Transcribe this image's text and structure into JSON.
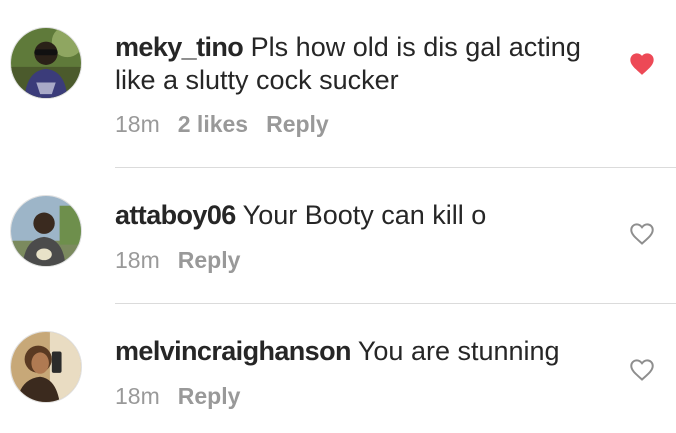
{
  "colors": {
    "liked_heart": "#ed4956",
    "meta_text": "#999999",
    "text": "#262626",
    "divider": "#dbdbdb"
  },
  "comments": [
    {
      "username": "meky_tino",
      "text": "Pls how old is dis gal acting like a slutty cock sucker",
      "time": "18m",
      "likes": "2 likes",
      "reply": "Reply",
      "liked": true,
      "heart_icon": "heart-filled-icon"
    },
    {
      "username": "attaboy06",
      "text": "Your Booty can kill o",
      "time": "18m",
      "reply": "Reply",
      "liked": false,
      "heart_icon": "heart-outline-icon"
    },
    {
      "username": "melvincraighanson",
      "text": "You are stunning",
      "time": "18m",
      "reply": "Reply",
      "liked": false,
      "heart_icon": "heart-outline-icon"
    }
  ]
}
